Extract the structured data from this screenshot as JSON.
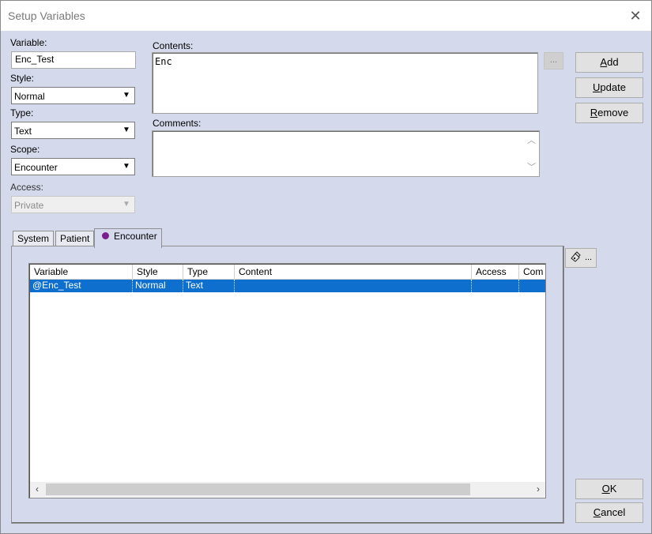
{
  "window": {
    "title": "Setup Variables"
  },
  "labels": {
    "variable": "Variable:",
    "style": "Style:",
    "type": "Type:",
    "scope": "Scope:",
    "access": "Access:",
    "contents": "Contents:",
    "comments": "Comments:"
  },
  "fields": {
    "variable": "Enc_Test",
    "style": "Normal",
    "type": "Text",
    "scope": "Encounter",
    "access": "Private",
    "contents": "Enc",
    "comments": ""
  },
  "buttons": {
    "ellipsis": "...",
    "add_ul": "A",
    "add_rest": "dd",
    "update_ul": "U",
    "update_rest": "pdate",
    "remove_ul": "R",
    "remove_rest": "emove",
    "ok_ul": "O",
    "ok_rest": "K",
    "cancel_ul": "C",
    "cancel_rest": "ancel",
    "icon_suffix": "..."
  },
  "tabs": [
    {
      "label": "System"
    },
    {
      "label": "Patient"
    },
    {
      "label": "Encounter"
    }
  ],
  "table": {
    "columns": [
      "Variable",
      "Style",
      "Type",
      "Content",
      "Access",
      "Com"
    ],
    "rows": [
      {
        "variable": "@Enc_Test",
        "style": "Normal",
        "type": "Text",
        "content": "",
        "access": "",
        "comments": ""
      }
    ]
  },
  "colors": {
    "dialog_bg": "#d4daeb",
    "selection": "#0e6fcf",
    "encounter_dot": "#7b1f8e"
  }
}
